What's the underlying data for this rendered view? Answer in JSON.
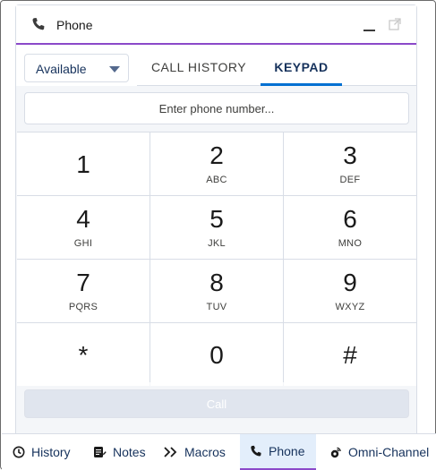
{
  "panel": {
    "title": "Phone",
    "icons": {
      "title": "phone-icon",
      "minimize": "minimize-icon",
      "popout": "popout-icon"
    }
  },
  "status": {
    "selected": "Available",
    "icon": "chevron-down-icon"
  },
  "tabs": [
    {
      "label": "CALL HISTORY",
      "active": false
    },
    {
      "label": "KEYPAD",
      "active": true
    }
  ],
  "phone_input": {
    "placeholder": "Enter phone number...",
    "value": ""
  },
  "keypad": [
    {
      "digit": "1",
      "letters": ""
    },
    {
      "digit": "2",
      "letters": "ABC"
    },
    {
      "digit": "3",
      "letters": "DEF"
    },
    {
      "digit": "4",
      "letters": "GHI"
    },
    {
      "digit": "5",
      "letters": "JKL"
    },
    {
      "digit": "6",
      "letters": "MNO"
    },
    {
      "digit": "7",
      "letters": "PQRS"
    },
    {
      "digit": "8",
      "letters": "TUV"
    },
    {
      "digit": "9",
      "letters": "WXYZ"
    },
    {
      "digit": "*",
      "letters": ""
    },
    {
      "digit": "0",
      "letters": ""
    },
    {
      "digit": "#",
      "letters": ""
    }
  ],
  "call_button": {
    "label": "Call",
    "enabled": false
  },
  "utility_bar": [
    {
      "label": "History",
      "icon": "clock-icon",
      "active": false
    },
    {
      "label": "Notes",
      "icon": "notes-icon",
      "active": false
    },
    {
      "label": "Macros",
      "icon": "macros-icon",
      "active": false
    },
    {
      "label": "Phone",
      "icon": "phone-icon",
      "active": true
    },
    {
      "label": "Omni-Channel",
      "icon": "omni-channel-icon",
      "active": false
    }
  ],
  "colors": {
    "accent_purple": "#8b49c9",
    "tab_active_blue": "#0070d2",
    "keypad_background": "#f4f6f9",
    "active_utility_background": "#e3eefb"
  }
}
